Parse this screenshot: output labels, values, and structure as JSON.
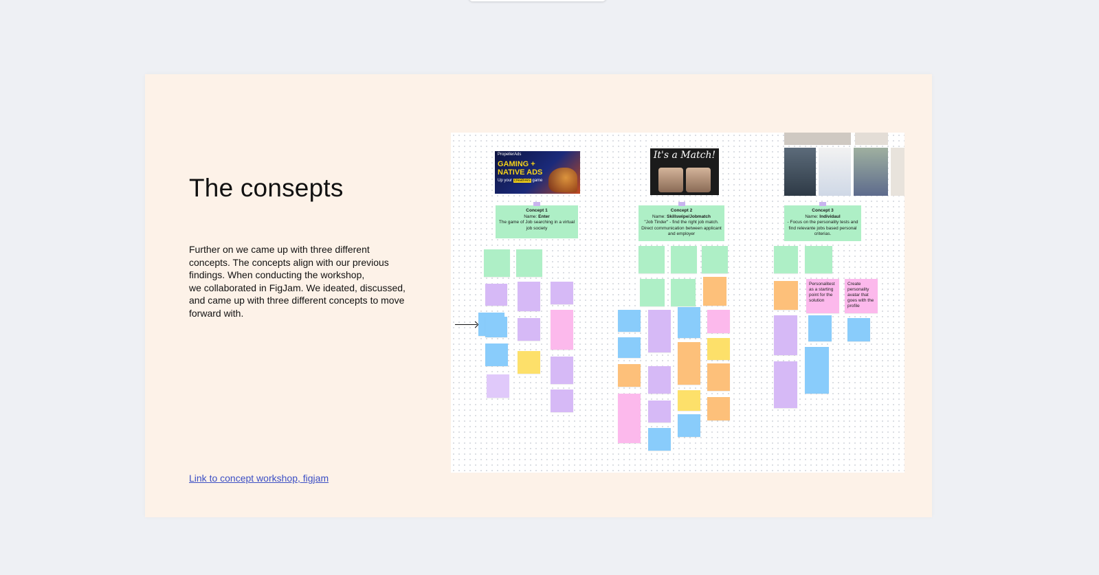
{
  "page": {
    "title": "The consepts",
    "description_lines": [
      "Further on we came up with three different",
      "concepts. The concepts align with our previous",
      "findings. When conducting the workshop,",
      "we collaborated in FigJam. We ideated, discussed,",
      "and came up with three different concepts to move",
      "forward with."
    ],
    "link_text": "Link to concept workshop, figjam"
  },
  "board": {
    "ad_image": {
      "brand": "PropellerAds",
      "headline": "GAMING + NATIVE ADS",
      "tagline_prefix": "Up your",
      "tagline_highlight": "creatives",
      "tagline_suffix": "game"
    },
    "match_image": {
      "heading": "It's a Match!"
    },
    "concepts": [
      {
        "label": "Concept 1",
        "name_prefix": "Name: ",
        "name": "Enter",
        "description": "The game of Job searching in a virtual job society"
      },
      {
        "label": "Concept 2",
        "name_prefix": "Name: ",
        "name": "Skillswipe/Jobmatch",
        "description": "\"Job Tinder\" - find the right job match. Direct communication between applicant and employer"
      },
      {
        "label": "Concept 3",
        "name_prefix": "Name: ",
        "name": "Individaul",
        "description": "- Focus on the personality tests and find relevante jobs based personal criterias."
      }
    ],
    "readable_notes": [
      "Personalitest as a starting point for the solution",
      "Create personality avatar that goes with the profile"
    ],
    "colors": {
      "green": "#aeefc6",
      "purple": "#d6b9f6",
      "blue": "#89ccfb",
      "orange": "#fdc07a",
      "pink": "#fcb9ec",
      "yellow": "#fde06a"
    }
  }
}
